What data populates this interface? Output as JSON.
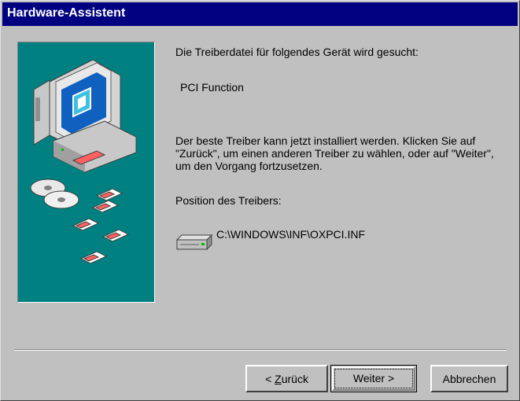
{
  "window": {
    "title": "Hardware-Assistent"
  },
  "content": {
    "intro": "Die Treiberdatei für folgendes Gerät wird gesucht:",
    "device_name": "PCI Function",
    "description": "Der beste Treiber kann jetzt installiert werden. Klicken Sie auf \"Zurück\", um einen anderen Treiber zu wählen, oder auf \"Weiter\", um den Vorgang fortzusetzen.",
    "position_label": "Position des Treibers:",
    "driver_path": "C:\\WINDOWS\\INF\\OXPCI.INF"
  },
  "buttons": {
    "back_prefix": "< ",
    "back_mnemonic": "Z",
    "back_rest": "urück",
    "next_label": "Weiter >",
    "cancel_label": "Abbrechen"
  },
  "icons": {
    "illustration": "computer-with-cds-and-floppies-icon",
    "drive": "hard-drive-icon"
  },
  "colors": {
    "titlebar": "#000080",
    "illustration_bg": "#008080",
    "dialog_bg": "#c0c0c0"
  }
}
